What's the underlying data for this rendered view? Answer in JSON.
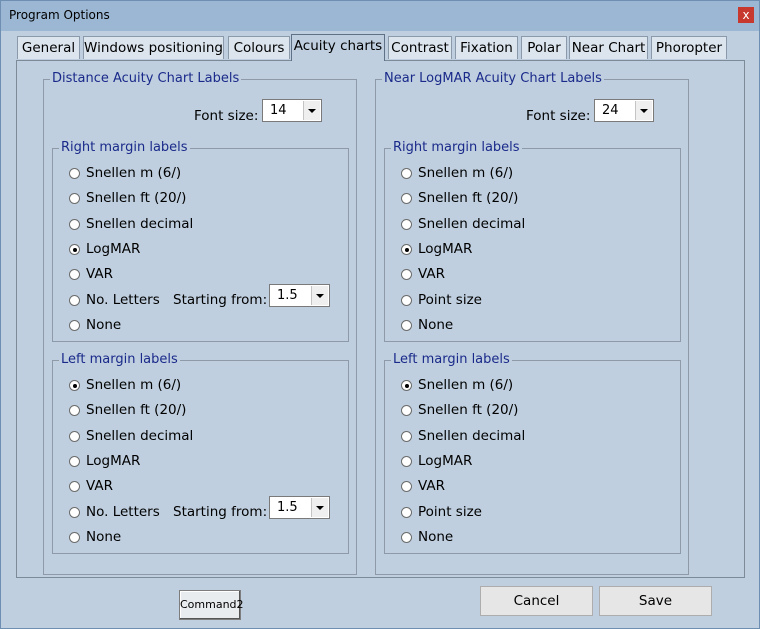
{
  "window": {
    "title": "Program Options",
    "close_glyph": "x"
  },
  "tabs": [
    "General",
    "Windows positioning",
    "Colours",
    "Acuity charts",
    "Contrast",
    "Fixation",
    "Polar",
    "Near Chart",
    "Phoropter"
  ],
  "active_tab": "Acuity charts",
  "distance": {
    "caption": "Distance Acuity Chart Labels",
    "font_size_label": "Font size:",
    "font_size_value": "14",
    "right": {
      "caption": "Right margin labels",
      "options": [
        "Snellen m (6/)",
        "Snellen ft (20/)",
        "Snellen decimal",
        "LogMAR",
        "VAR",
        "No. Letters",
        "None"
      ],
      "selected": "LogMAR",
      "starting_from_label": "Starting from:",
      "starting_from_value": "1.5"
    },
    "left": {
      "caption": "Left margin labels",
      "options": [
        "Snellen m (6/)",
        "Snellen ft (20/)",
        "Snellen decimal",
        "LogMAR",
        "VAR",
        "No. Letters",
        "None"
      ],
      "selected": "Snellen m (6/)",
      "starting_from_label": "Starting from:",
      "starting_from_value": "1.5"
    }
  },
  "near": {
    "caption": "Near LogMAR Acuity Chart Labels",
    "font_size_label": "Font size:",
    "font_size_value": "24",
    "right": {
      "caption": "Right margin labels",
      "options": [
        "Snellen m (6/)",
        "Snellen ft (20/)",
        "Snellen decimal",
        "LogMAR",
        "VAR",
        "Point size",
        "None"
      ],
      "selected": "LogMAR"
    },
    "left": {
      "caption": "Left margin labels",
      "options": [
        "Snellen m (6/)",
        "Snellen ft (20/)",
        "Snellen decimal",
        "LogMAR",
        "VAR",
        "Point size",
        "None"
      ],
      "selected": "Snellen m (6/)"
    }
  },
  "buttons": {
    "command2": "Command2",
    "cancel": "Cancel",
    "save": "Save"
  }
}
